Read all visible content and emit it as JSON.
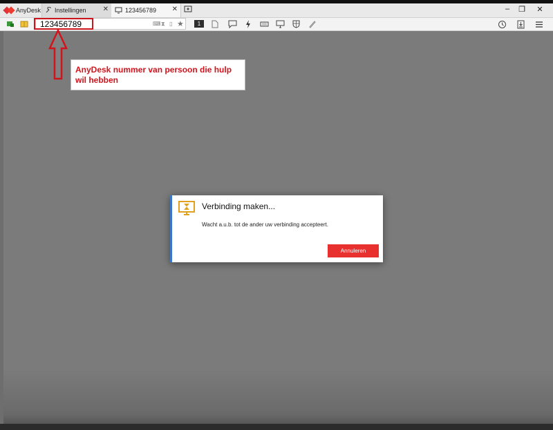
{
  "tabs": {
    "brand": "AnyDesk",
    "settings": "Instellingen",
    "session": "123456789"
  },
  "address": {
    "value": "123456789"
  },
  "toolbar": {
    "monitor_number": "1"
  },
  "annotation": {
    "text": "AnyDesk nummer van persoon die hulp wil hebben"
  },
  "dialog": {
    "title": "Verbinding maken...",
    "message": "Wacht a.u.b. tot de ander uw verbinding accepteert.",
    "cancel_label": "Annuleren"
  },
  "colors": {
    "brand_red": "#e0343a",
    "annotation_red": "#d0141c",
    "accent_blue": "#3a78c9",
    "hourglass_gold": "#e0a21e",
    "cancel_red": "#e8302f"
  },
  "icons": [
    "anydesk-logo-icon",
    "wrench-icon",
    "monitor-icon",
    "close-icon",
    "new-tab-icon",
    "minimize-icon",
    "restore-icon",
    "window-close-icon",
    "connection-icon",
    "address-book-icon",
    "keyboard-icon",
    "hourglass-icon",
    "file-icon",
    "star-icon",
    "file-transfer-icon",
    "chat-icon",
    "lightning-icon",
    "display-icon",
    "shield-icon",
    "pen-icon",
    "history-icon",
    "download-icon",
    "menu-icon"
  ]
}
